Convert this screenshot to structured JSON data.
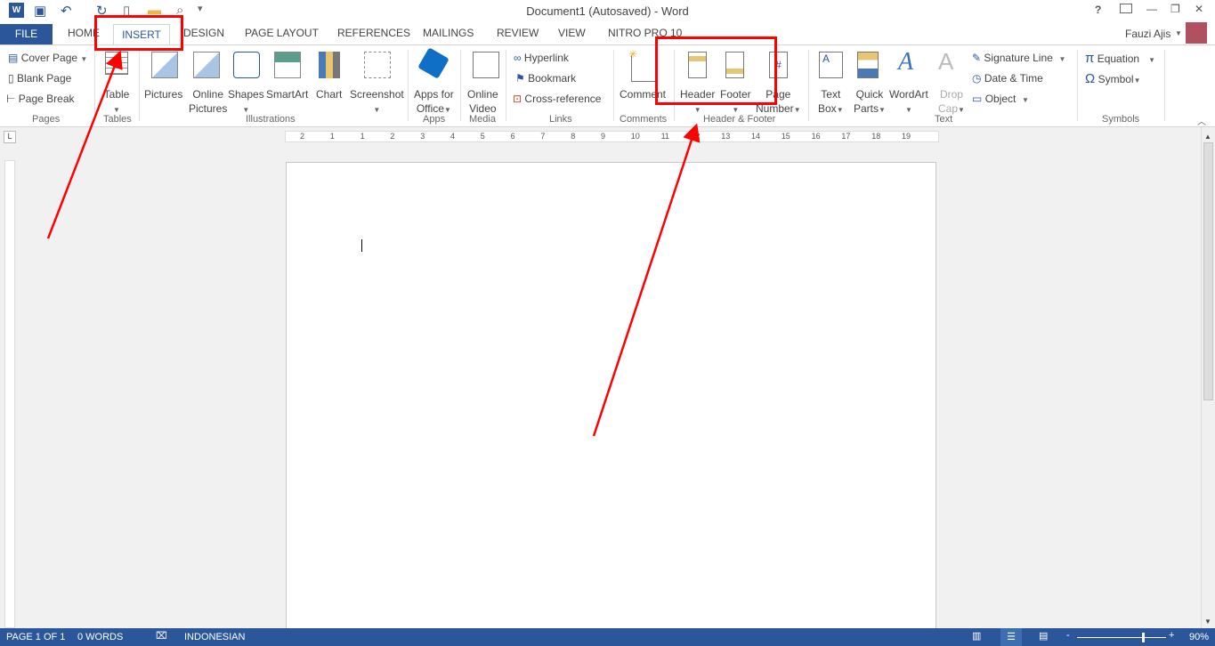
{
  "window": {
    "title": "Document1 (Autosaved) - Word",
    "user": "Fauzi Ajis",
    "help": "?",
    "min": "—",
    "restore": "❐",
    "close": "✕"
  },
  "tabs": [
    "FILE",
    "HOME",
    "INSERT",
    "DESIGN",
    "PAGE LAYOUT",
    "REFERENCES",
    "MAILINGS",
    "REVIEW",
    "VIEW",
    "NITRO PRO 10"
  ],
  "ribbon": {
    "pages": {
      "label": "Pages",
      "items": [
        "Cover Page",
        "Blank Page",
        "Page Break"
      ]
    },
    "tables": {
      "label": "Tables",
      "table": "Table"
    },
    "illustrations": {
      "label": "Illustrations",
      "items": [
        "Pictures",
        "Online",
        "Pictures",
        "Shapes",
        "SmartArt",
        "Chart",
        "Screenshot"
      ]
    },
    "apps": {
      "label": "Apps",
      "l1": "Apps for",
      "l2": "Office"
    },
    "media": {
      "label": "Media",
      "l1": "Online",
      "l2": "Video"
    },
    "links": {
      "label": "Links",
      "items": [
        "Hyperlink",
        "Bookmark",
        "Cross-reference"
      ]
    },
    "comments": {
      "label": "Comments",
      "comment": "Comment"
    },
    "header_footer": {
      "label": "Header & Footer",
      "header": "Header",
      "footer": "Footer",
      "pn1": "Page",
      "pn2": "Number"
    },
    "text": {
      "label": "Text",
      "tb1": "Text",
      "tb2": "Box",
      "qp1": "Quick",
      "qp2": "Parts",
      "wordart": "WordArt",
      "dc1": "Drop",
      "dc2": "Cap",
      "items": [
        "Signature Line",
        "Date & Time",
        "Object"
      ]
    },
    "symbols": {
      "label": "Symbols",
      "equation": "Equation",
      "symbol": "Symbol"
    }
  },
  "ruler": {
    "marks": [
      "2",
      "1",
      "1",
      "2",
      "3",
      "4",
      "5",
      "6",
      "7",
      "8",
      "9",
      "10",
      "11",
      "12",
      "13",
      "14",
      "15",
      "16",
      "17",
      "18",
      "19"
    ]
  },
  "status": {
    "page": "PAGE 1 OF 1",
    "words": "0 WORDS",
    "language": "INDONESIAN",
    "zoom": "90%",
    "zoom_level": 90
  },
  "colors": {
    "accent": "#2b579a",
    "annotation": "#ff0000"
  }
}
